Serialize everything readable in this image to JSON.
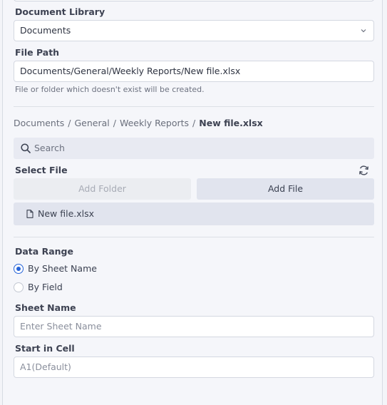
{
  "library": {
    "label": "Document Library",
    "value": "Documents"
  },
  "file_path": {
    "label": "File Path",
    "value": "Documents/General/Weekly Reports/New file.xlsx",
    "hint": "File or folder which doesn't exist will be created."
  },
  "breadcrumb": {
    "items": [
      "Documents",
      "General",
      "Weekly Reports"
    ],
    "current": "New file.xlsx",
    "separator": "/"
  },
  "search": {
    "placeholder": "Search"
  },
  "select_file": {
    "label": "Select File",
    "add_folder_label": "Add Folder",
    "add_file_label": "Add File",
    "files": [
      "New file.xlsx"
    ]
  },
  "data_range": {
    "label": "Data Range",
    "options": [
      {
        "label": "By Sheet Name",
        "selected": true
      },
      {
        "label": "By Field",
        "selected": false
      }
    ]
  },
  "sheet_name": {
    "label": "Sheet Name",
    "placeholder": "Enter Sheet Name"
  },
  "start_cell": {
    "label": "Start in Cell",
    "placeholder": "A1(Default)"
  },
  "colors": {
    "accent": "#2563d8",
    "panel": "#f5f6fa",
    "button": "#e1e4ee"
  },
  "icons": [
    "chevron-down-icon",
    "search-icon",
    "refresh-icon",
    "file-icon"
  ]
}
